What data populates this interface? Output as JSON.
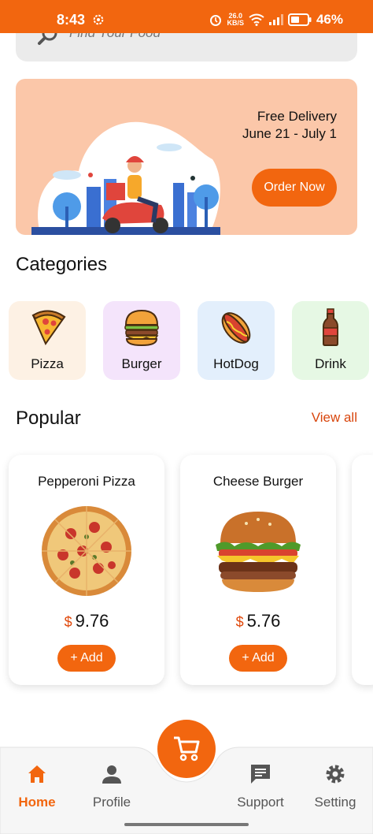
{
  "status_bar": {
    "time": "8:43",
    "net_speed_value": "26.0",
    "net_speed_unit": "KB/S",
    "battery": "46%"
  },
  "search": {
    "placeholder": "Find Your Food"
  },
  "promo": {
    "title": "Free Delivery",
    "dates": "June 21 - July 1",
    "button": "Order Now"
  },
  "categories": {
    "heading": "Categories",
    "items": [
      {
        "label": "Pizza",
        "icon": "pizza-icon",
        "bg": "#fdf1e4"
      },
      {
        "label": "Burger",
        "icon": "burger-icon",
        "bg": "#f4e4fb"
      },
      {
        "label": "HotDog",
        "icon": "hotdog-icon",
        "bg": "#e3effc"
      },
      {
        "label": "Drink",
        "icon": "drink-icon",
        "bg": "#e6f8e4"
      }
    ]
  },
  "popular": {
    "heading": "Popular",
    "view_all": "View all",
    "items": [
      {
        "name": "Pepperoni Pizza",
        "currency": "$",
        "price": "9.76",
        "add": "+ Add"
      },
      {
        "name": "Cheese Burger",
        "currency": "$",
        "price": "5.76",
        "add": "+ Add"
      }
    ]
  },
  "nav": {
    "items": [
      {
        "label": "Home",
        "icon": "home-icon",
        "active": true
      },
      {
        "label": "Profile",
        "icon": "profile-icon",
        "active": false
      },
      {
        "label": "Support",
        "icon": "support-icon",
        "active": false
      },
      {
        "label": "Setting",
        "icon": "gear-icon",
        "active": false
      }
    ],
    "fab_icon": "cart-icon"
  },
  "colors": {
    "accent": "#f2660f",
    "promo_bg": "#fbc7a9",
    "link": "#d8450c"
  }
}
